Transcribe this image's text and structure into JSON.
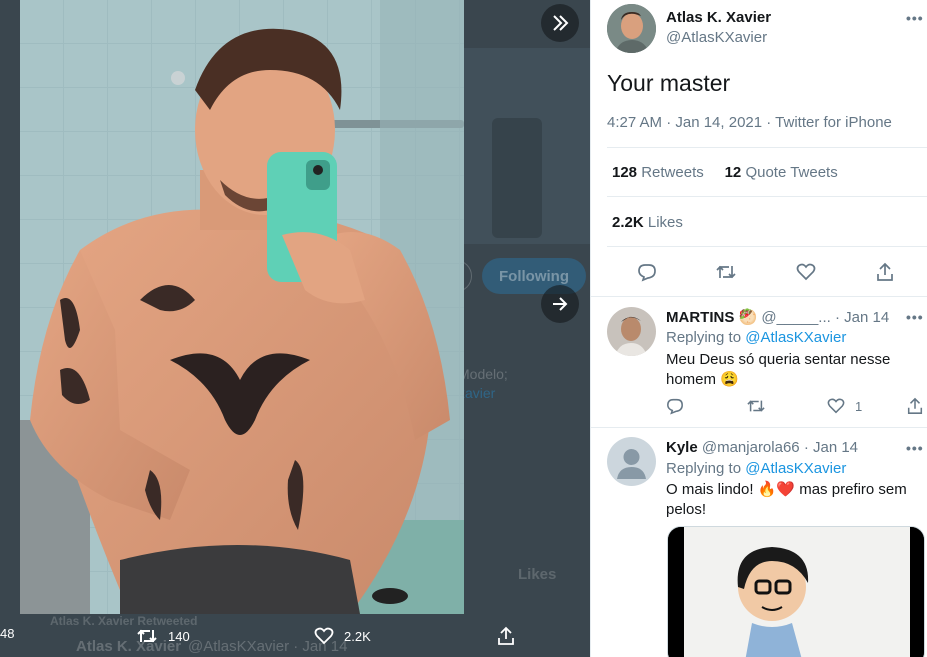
{
  "viewer": {
    "background_text": {
      "following": "Following",
      "modelo": "Modelo;",
      "xavier": "xavier",
      "likes": "Likes",
      "retweeted": "Atlas K. Xavier Retweeted",
      "name": "Atlas K. Xavier",
      "handle": "@AtlasKXavier · Jan 14"
    },
    "actions": {
      "replies": "48",
      "retweets": "140",
      "likes": "2.2K"
    },
    "icons": [
      "expand-icon",
      "next-arrow-icon",
      "retweet-icon",
      "heart-icon",
      "share-icon"
    ]
  },
  "tweet": {
    "author_name": "Atlas K. Xavier",
    "author_handle": "@AtlasKXavier",
    "text": "Your master",
    "meta": "4:27 AM · Jan 14, 2021 · Twitter for iPhone",
    "retweets_count": "128",
    "retweets_label": "Retweets",
    "quote_count": "12",
    "quote_label": "Quote Tweets",
    "likes_count": "2.2K",
    "likes_label": "Likes",
    "more": "•••"
  },
  "replies": [
    {
      "name": "MARTINS 🥙",
      "handle": "@_____...",
      "date": "· Jan 14",
      "replying_prefix": "Replying to",
      "replying_to": "@AtlasKXavier",
      "text": "Meu Deus só queria sentar nesse homem 😩",
      "likes": "1",
      "more": "•••"
    },
    {
      "name": "Kyle",
      "handle": "@manjarola66",
      "date": "· Jan 14",
      "replying_prefix": "Replying to",
      "replying_to": "@AtlasKXavier",
      "text": "O mais lindo! 🔥❤️ mas prefiro sem pelos!",
      "more": "•••"
    }
  ],
  "colors": {
    "link": "#1b95e0",
    "secondary_text": "#657786",
    "viewer_bg": "#3a464e"
  }
}
